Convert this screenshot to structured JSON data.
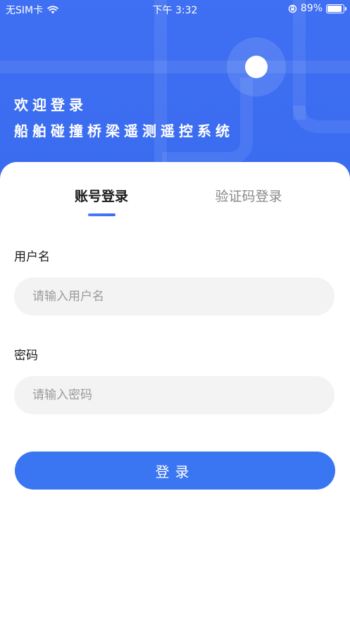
{
  "status_bar": {
    "carrier": "无SIM卡",
    "time": "下午 3:32",
    "battery_percent": "89%",
    "battery_level": 0.89,
    "icons": [
      "wifi-icon",
      "rotation-lock-icon",
      "battery-icon"
    ]
  },
  "header": {
    "welcome": "欢迎登录",
    "system_title": "船舶碰撞桥梁遥测遥控系统"
  },
  "tabs": {
    "account": "账号登录",
    "code": "验证码登录",
    "active": "account"
  },
  "form": {
    "username_label": "用户名",
    "username_placeholder": "请输入用户名",
    "username_value": "",
    "password_label": "密码",
    "password_placeholder": "请输入密码",
    "password_value": "",
    "login_button": "登录"
  },
  "colors": {
    "header_bg": "#3f6ff2",
    "primary_button": "#3a76f2",
    "input_bg": "#f3f3f3",
    "tab_active": "#1a1a1a",
    "tab_inactive": "#888888"
  }
}
